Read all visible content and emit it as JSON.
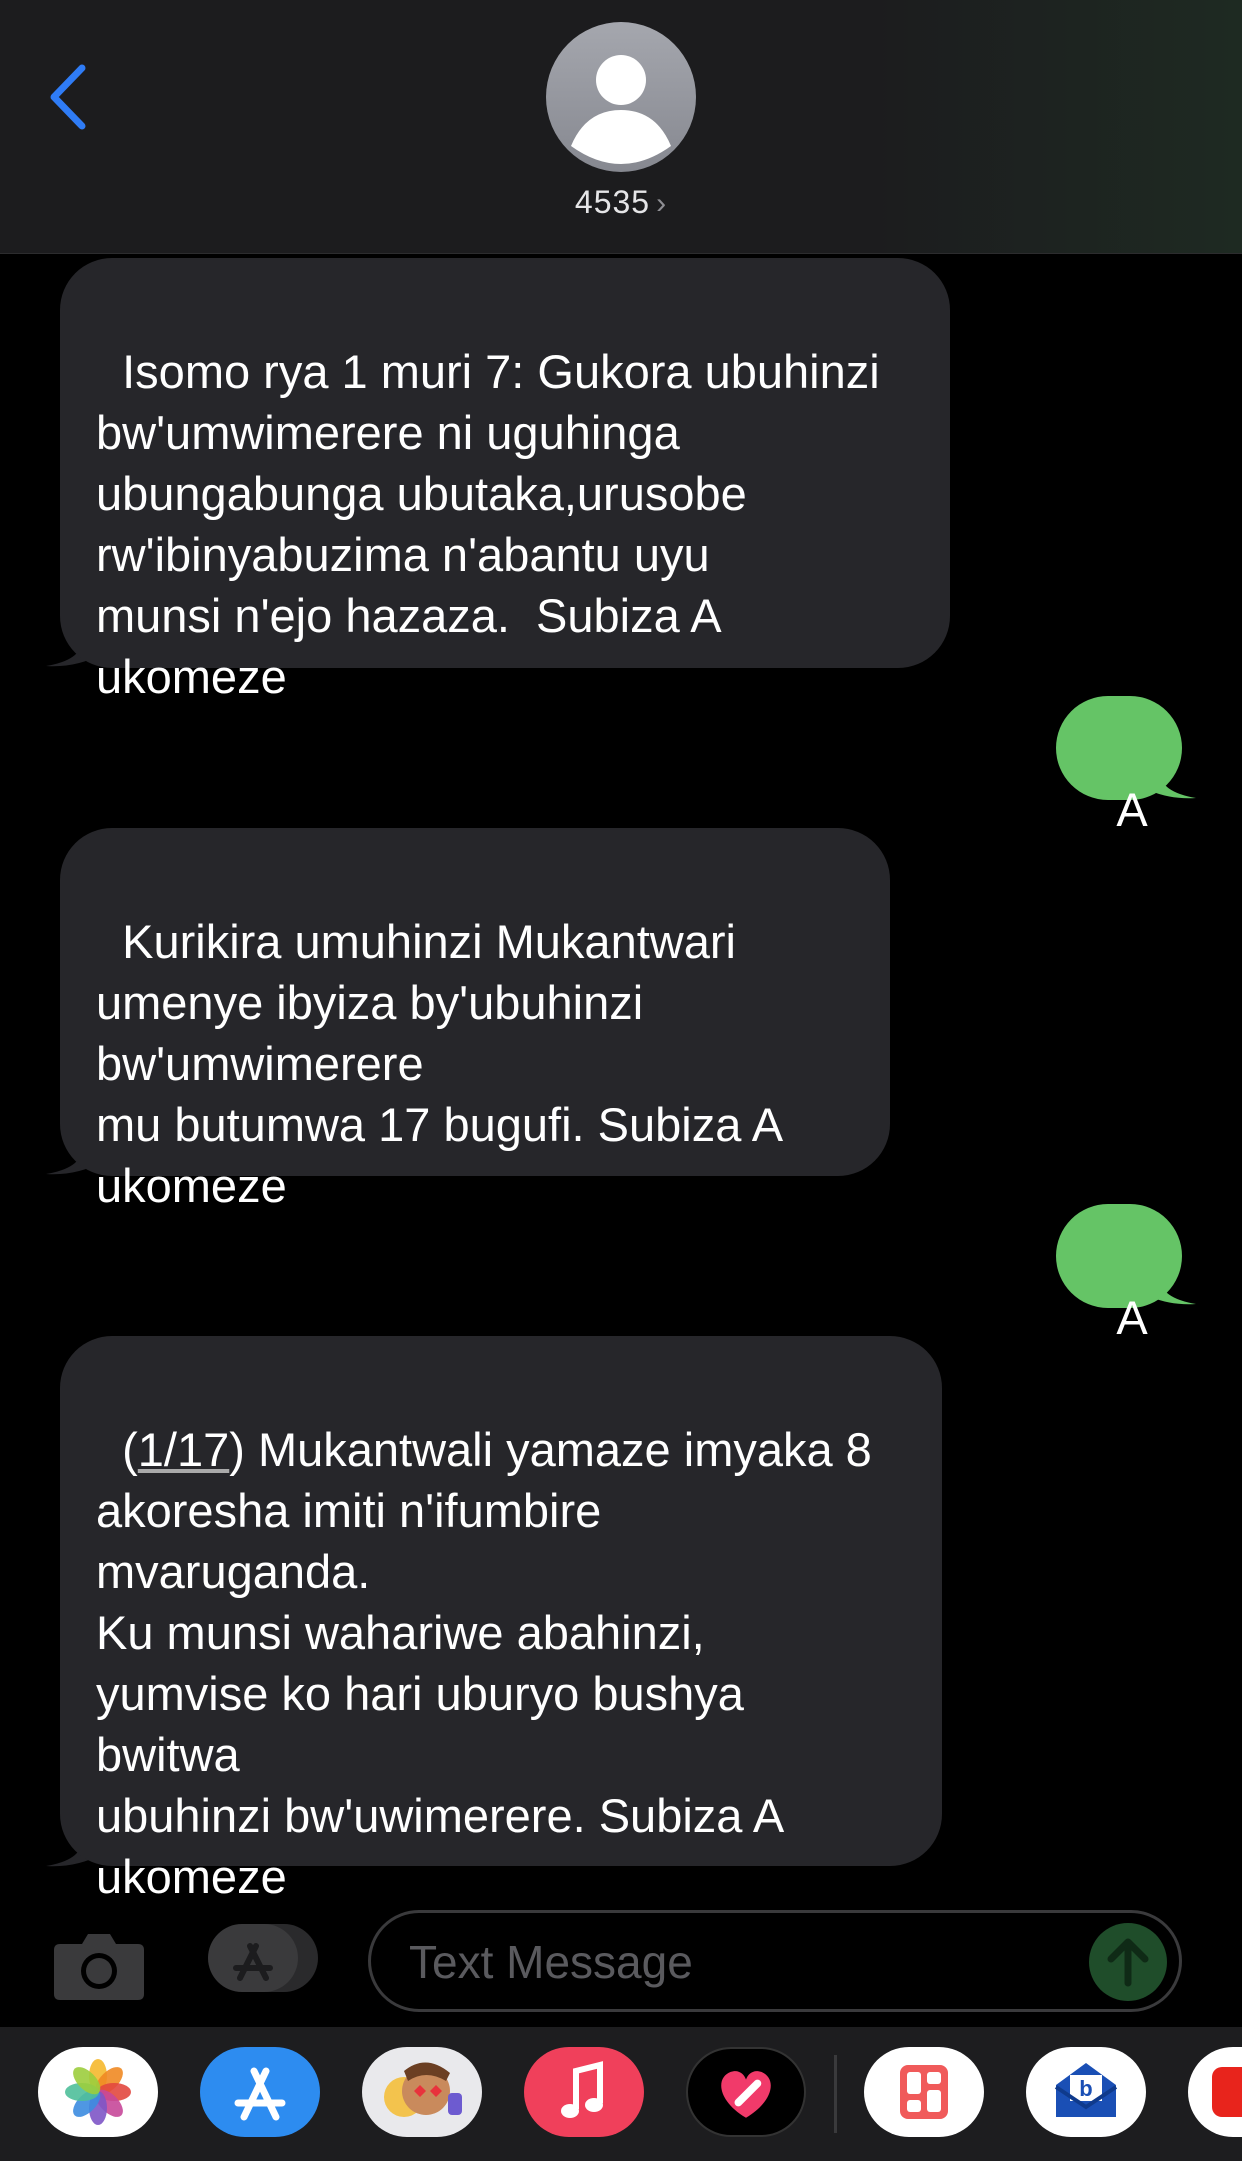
{
  "header": {
    "contact_name": "4535",
    "chevron": "›"
  },
  "messages": [
    {
      "direction": "incoming",
      "text": "Isomo rya 1 muri 7: Gukora ubuhinzi\nbw'umwimerere ni uguhinga\nubungabunga ubutaka,urusobe\nrw'ibinyabuzima n'abantu uyu\nmunsi n'ejo hazaza.  Subiza A\nukomeze"
    },
    {
      "direction": "outgoing",
      "text": "A"
    },
    {
      "direction": "incoming",
      "text": "Kurikira umuhinzi Mukantwari\numenye ibyiza by'ubuhinzi\nbw'umwimerere\nmu butumwa 17 bugufi. Subiza A\nukomeze"
    },
    {
      "direction": "outgoing",
      "text": "A"
    },
    {
      "direction": "incoming",
      "prefix": "(",
      "link": "1/17",
      "text": ") Mukantwali yamaze imyaka 8\nakoresha imiti n'ifumbire\nmvaruganda.\nKu munsi wahariwe abahinzi,\nyumvise ko hari uburyo bushya\nbwitwa\nubuhinzi bw'uwimerere. Subiza A\nukomeze"
    }
  ],
  "compose": {
    "placeholder": "Text Message"
  },
  "dock_apps": [
    "photos-app",
    "app-store-app",
    "memoji-app",
    "music-app",
    "fitness-heart-app",
    "dashboard-app",
    "mail-app",
    "red-app"
  ],
  "colors": {
    "incoming_bubble": "#26262a",
    "outgoing_bubble": "#65c466",
    "accent_blue": "#2f7cf6"
  }
}
